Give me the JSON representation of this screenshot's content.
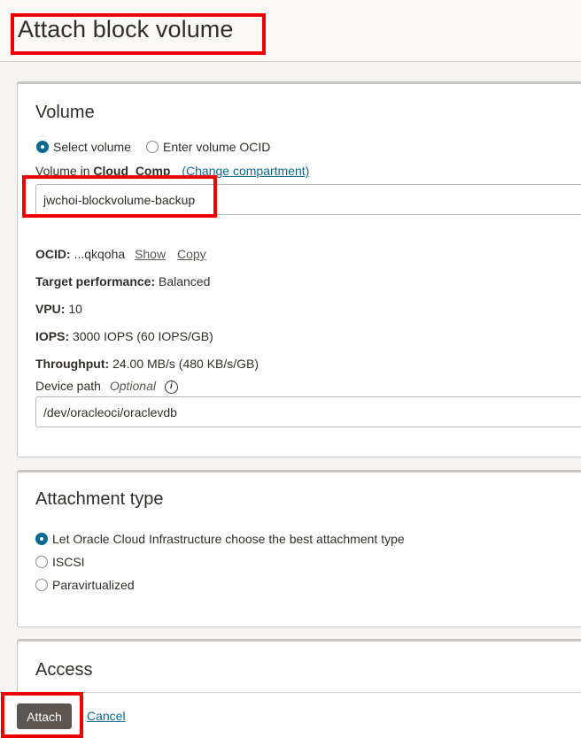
{
  "header": {
    "title": "Attach block volume"
  },
  "volume": {
    "title": "Volume",
    "radio_select_label": "Select volume",
    "radio_ocid_label": "Enter volume OCID",
    "volume_in_label": "Volume in",
    "compartment": "Cloud_Comp",
    "change_compartment": "(Change compartment)",
    "selected_volume": "jwchoi-blockvolume-backup",
    "ocid_label": "OCID:",
    "ocid_value": "...qkqoha",
    "show": "Show",
    "copy": "Copy",
    "target_perf_label": "Target performance:",
    "target_perf_value": "Balanced",
    "vpu_label": "VPU:",
    "vpu_value": "10",
    "iops_label": "IOPS:",
    "iops_value": "3000 IOPS (60 IOPS/GB)",
    "throughput_label": "Throughput:",
    "throughput_value": "24.00 MB/s (480 KB/s/GB)",
    "device_path_label": "Device path",
    "optional": "Optional",
    "info_glyph": "i",
    "device_path_value": "/dev/oracleoci/oraclevdb"
  },
  "attachment": {
    "title": "Attachment type",
    "options": [
      "Let Oracle Cloud Infrastructure choose the best attachment type",
      "ISCSI",
      "Paravirtualized"
    ]
  },
  "access": {
    "title": "Access"
  },
  "footer": {
    "attach": "Attach",
    "cancel": "Cancel"
  },
  "colors": {
    "highlight": "#ee0000",
    "link": "#0a6a8f",
    "button": "#5b5652",
    "radio_selected": "#0a6a8f"
  },
  "icons": {
    "info": "info-icon"
  }
}
